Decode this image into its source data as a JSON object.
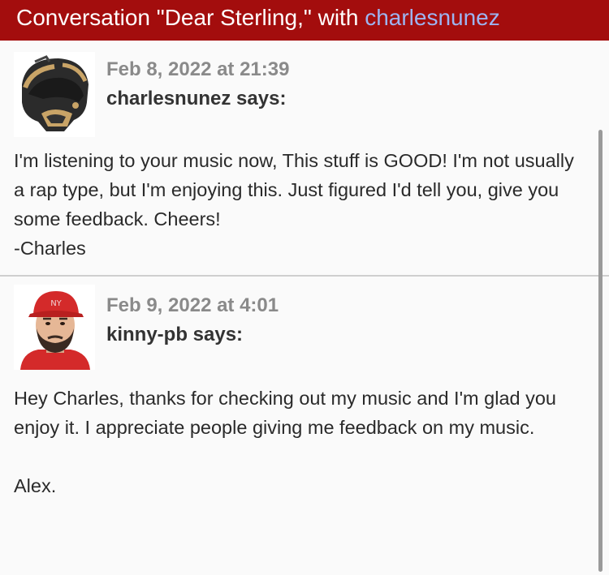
{
  "header": {
    "title_prefix": "Conversation \"Dear Sterling,\" with ",
    "title_user": "charlesnunez"
  },
  "messages": [
    {
      "date": "Feb 8, 2022 at 21:39",
      "author": "charlesnunez says:",
      "avatar_icon": "motorcycle-helmet-avatar",
      "lines": [
        "I'm listening to your music now, This stuff is GOOD! I'm not usually a rap type, but I'm enjoying this. Just figured I'd tell you, give you some feedback. Cheers!",
        "-Charles"
      ]
    },
    {
      "date": "Feb 9, 2022 at 4:01",
      "author": "kinny-pb says:",
      "avatar_icon": "man-red-cap-avatar",
      "lines": [
        "Hey Charles, thanks for checking out my music and I'm glad you enjoy it. I appreciate people giving me feedback on my music.",
        "",
        "Alex."
      ]
    }
  ],
  "colors": {
    "header_bg": "#a30d0d",
    "link": "#9db4f0",
    "date": "#8a8a8a"
  }
}
